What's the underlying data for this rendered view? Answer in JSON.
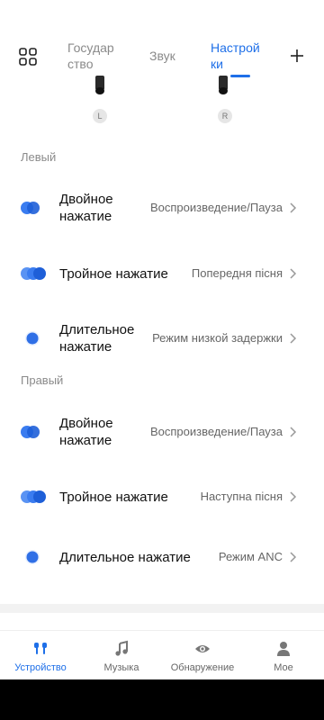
{
  "tabs": [
    {
      "label_line1": "Государ",
      "label_line2": "ство"
    },
    {
      "label": "Звук"
    },
    {
      "label_line1": "Настрой",
      "label_line2": "ки"
    }
  ],
  "buds": {
    "left": "L",
    "right": "R"
  },
  "left_section": {
    "label": "Левый",
    "rows": [
      {
        "title_line1": "Двойное",
        "title_line2": "нажатие",
        "value": "Воспроизведение/Пауза"
      },
      {
        "title": "Тройное нажатие",
        "value": "Попередня пісня"
      },
      {
        "title_line1": "Длительное",
        "title_line2": "нажатие",
        "value": "Режим низкой задержки"
      }
    ]
  },
  "right_section": {
    "label": "Правый",
    "rows": [
      {
        "title_line1": "Двойное",
        "title_line2": "нажатие",
        "value": "Воспроизведение/Пауза"
      },
      {
        "title": "Тройное нажатие",
        "value": "Наступна пісня"
      },
      {
        "title": "Длительное нажатие",
        "value": "Режим ANC"
      }
    ]
  },
  "bottom_nav": [
    {
      "label": "Устройство",
      "icon": "earbuds-icon",
      "active": true
    },
    {
      "label": "Музыка",
      "icon": "music-note-icon"
    },
    {
      "label": "Обнаружение",
      "icon": "eye-icon"
    },
    {
      "label": "Мое",
      "icon": "person-icon"
    }
  ],
  "colors": {
    "accent": "#1e6fe8",
    "text": "#111111",
    "secondary": "#666666"
  }
}
